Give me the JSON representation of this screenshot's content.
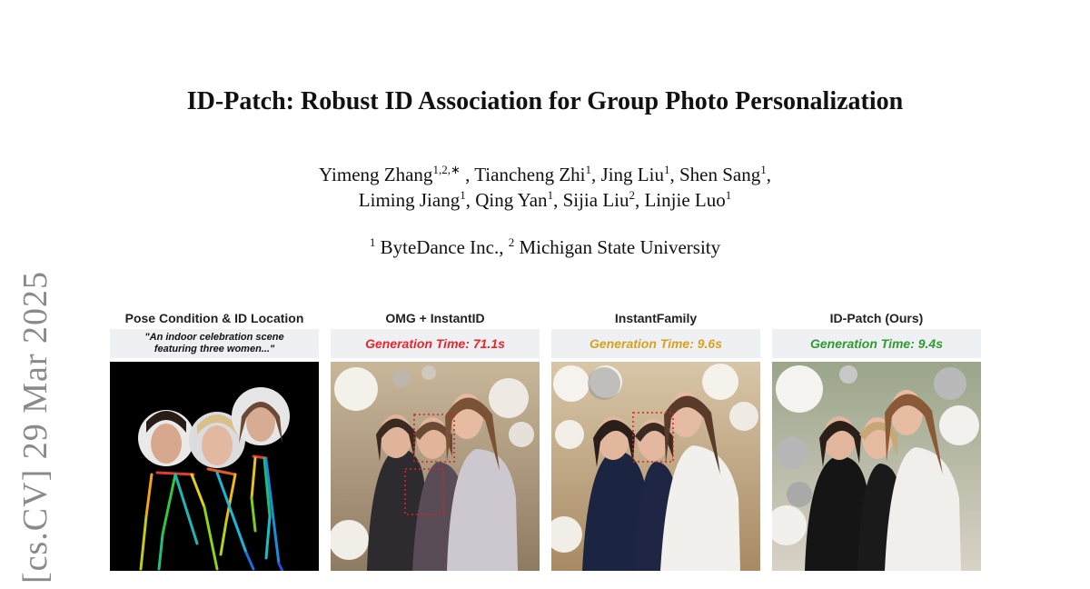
{
  "arxiv_stamp": "[cs.CV]  29 Mar 2025",
  "title": "ID-Patch: Robust ID Association for Group Photo Personalization",
  "authors": {
    "line1": [
      {
        "name": "Yimeng Zhang",
        "sup": "1,2,∗",
        "sep": " , "
      },
      {
        "name": "Tiancheng Zhi",
        "sup": "1",
        "sep": ", "
      },
      {
        "name": "Jing Liu",
        "sup": "1",
        "sep": ", "
      },
      {
        "name": "Shen Sang",
        "sup": "1",
        "sep": ","
      }
    ],
    "line2": [
      {
        "name": "Liming Jiang",
        "sup": "1",
        "sep": ", "
      },
      {
        "name": "Qing Yan",
        "sup": "1",
        "sep": ", "
      },
      {
        "name": "Sijia Liu",
        "sup": "2",
        "sep": ", "
      },
      {
        "name": "Linjie Luo",
        "sup": "1",
        "sep": ""
      }
    ]
  },
  "affiliations": [
    {
      "sup": "1",
      "name": "ByteDance Inc.",
      "sep": ", "
    },
    {
      "sup": "2",
      "name": "Michigan State University",
      "sep": ""
    }
  ],
  "figure": {
    "panels": [
      {
        "title": "Pose Condition & ID Location",
        "caption": "\"An indoor celebration scene featuring three women...\""
      },
      {
        "title": "OMG + InstantID",
        "caption": "Generation Time:  71.1s",
        "color": "#e8262a"
      },
      {
        "title": "InstantFamily",
        "caption": "Generation Time:  9.6s",
        "color": "#d6a11d"
      },
      {
        "title": "ID-Patch (Ours)",
        "caption": "Generation Time:  9.4s",
        "color": "#2e9b2e"
      }
    ]
  }
}
